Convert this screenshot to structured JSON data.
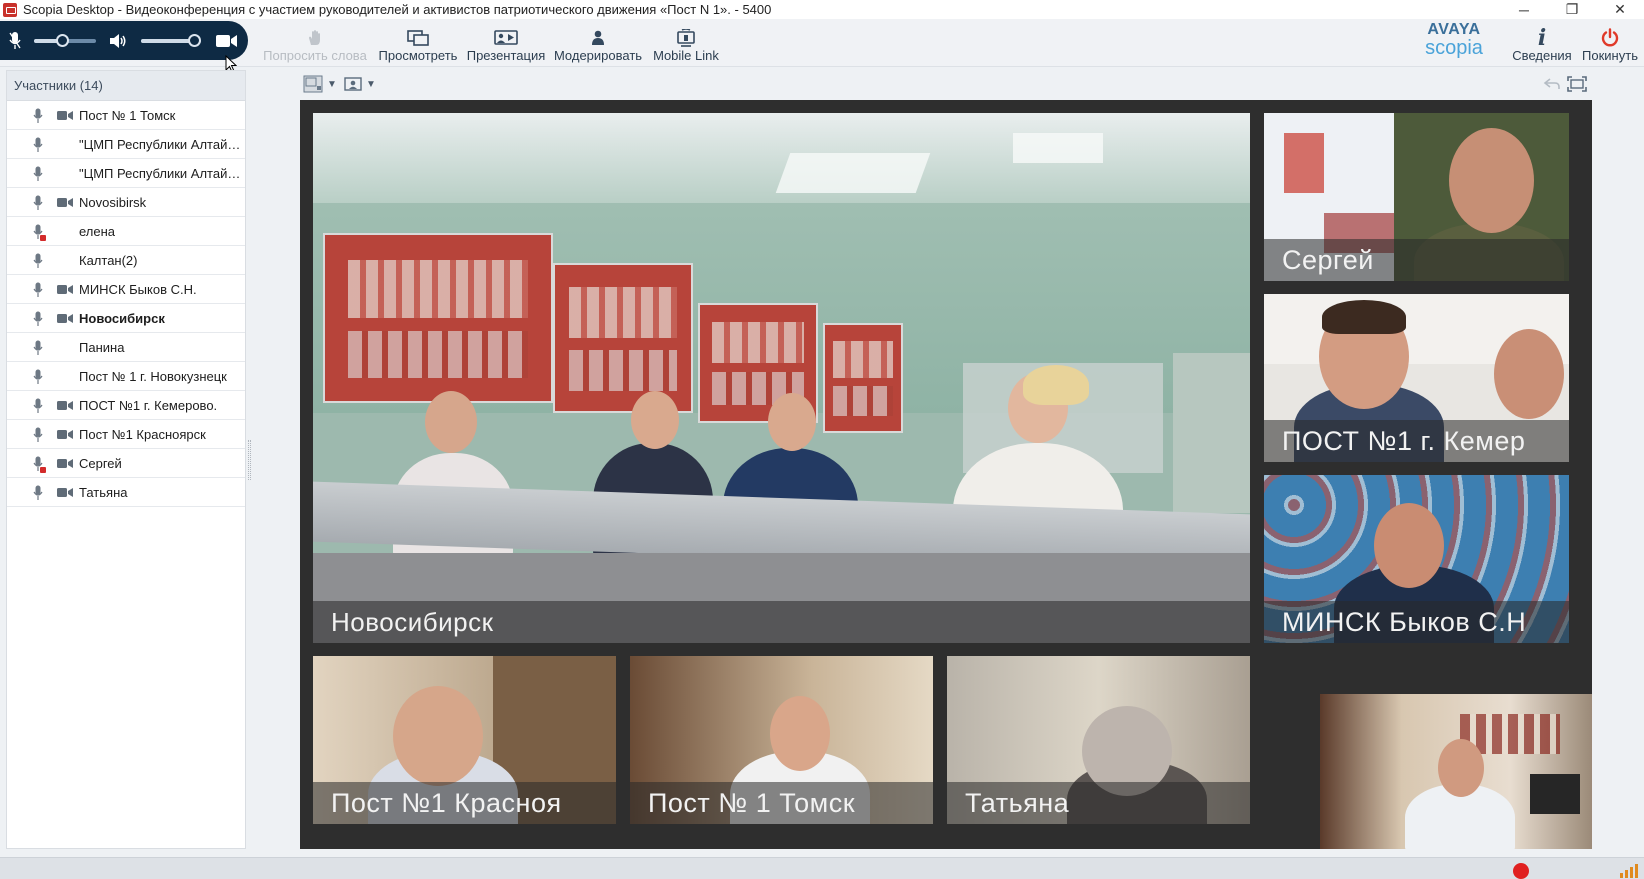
{
  "window": {
    "title": "Scopia Desktop - Видеоконференция с участием руководителей и активистов патриотического движения «Пост N 1». - 5400",
    "controls": {
      "minimize": "─",
      "restore": "❐",
      "close": "✕"
    }
  },
  "audio": {
    "mic_volume": 0.45,
    "speaker_volume": 0.88
  },
  "toolbar": {
    "request_floor": "Попросить слова",
    "view": "Просмотреть",
    "presentation": "Презентация",
    "moderate": "Модерировать",
    "mobile_link": "Mobile Link",
    "info": "Сведения",
    "leave": "Покинуть"
  },
  "brand": {
    "line1": "AVAYA",
    "line2": "scopia"
  },
  "participants": {
    "header": "Участники (14)",
    "items": [
      {
        "name": "Пост № 1 Томск",
        "camera": true,
        "bold": false,
        "mic_locked": false
      },
      {
        "name": "\"ЦМП Республики Алтай\" г.Горно-Алтайск",
        "camera": false,
        "bold": false,
        "mic_locked": false
      },
      {
        "name": "\"ЦМП Республики Алтай\" г.Горно-Алтайск",
        "camera": false,
        "bold": false,
        "mic_locked": false
      },
      {
        "name": "Novosibirsk",
        "camera": true,
        "bold": false,
        "mic_locked": false
      },
      {
        "name": "елена",
        "camera": false,
        "bold": false,
        "mic_locked": true
      },
      {
        "name": "Калтан(2)",
        "camera": false,
        "bold": false,
        "mic_locked": false
      },
      {
        "name": "МИНСК Быков С.Н.",
        "camera": true,
        "bold": false,
        "mic_locked": false
      },
      {
        "name": "Новосибирск",
        "camera": true,
        "bold": true,
        "mic_locked": false
      },
      {
        "name": "Панина",
        "camera": false,
        "bold": false,
        "mic_locked": false
      },
      {
        "name": "Пост № 1 г. Новокузнецк",
        "camera": false,
        "bold": false,
        "mic_locked": false
      },
      {
        "name": "ПОСТ №1 г. Кемерово.",
        "camera": true,
        "bold": false,
        "mic_locked": false
      },
      {
        "name": "Пост №1 Красноярск",
        "camera": true,
        "bold": false,
        "mic_locked": false
      },
      {
        "name": "Сергей",
        "camera": true,
        "bold": false,
        "mic_locked": true
      },
      {
        "name": "Татьяна",
        "camera": true,
        "bold": false,
        "mic_locked": false
      }
    ]
  },
  "video": {
    "main_label": "Новосибирск",
    "side": [
      {
        "label": "Сергей"
      },
      {
        "label": "ПОСТ №1 г. Кемер"
      },
      {
        "label": "МИНСК Быков С.Н"
      }
    ],
    "bottom": [
      {
        "label": "Пост №1 Красноя"
      },
      {
        "label": "Пост № 1 Томск"
      },
      {
        "label": "Татьяна"
      }
    ]
  },
  "colors": {
    "accent": "#0e2a44",
    "leave_red": "#e03a2a",
    "record_red": "#e02020",
    "signal_orange": "#e08a1e"
  }
}
